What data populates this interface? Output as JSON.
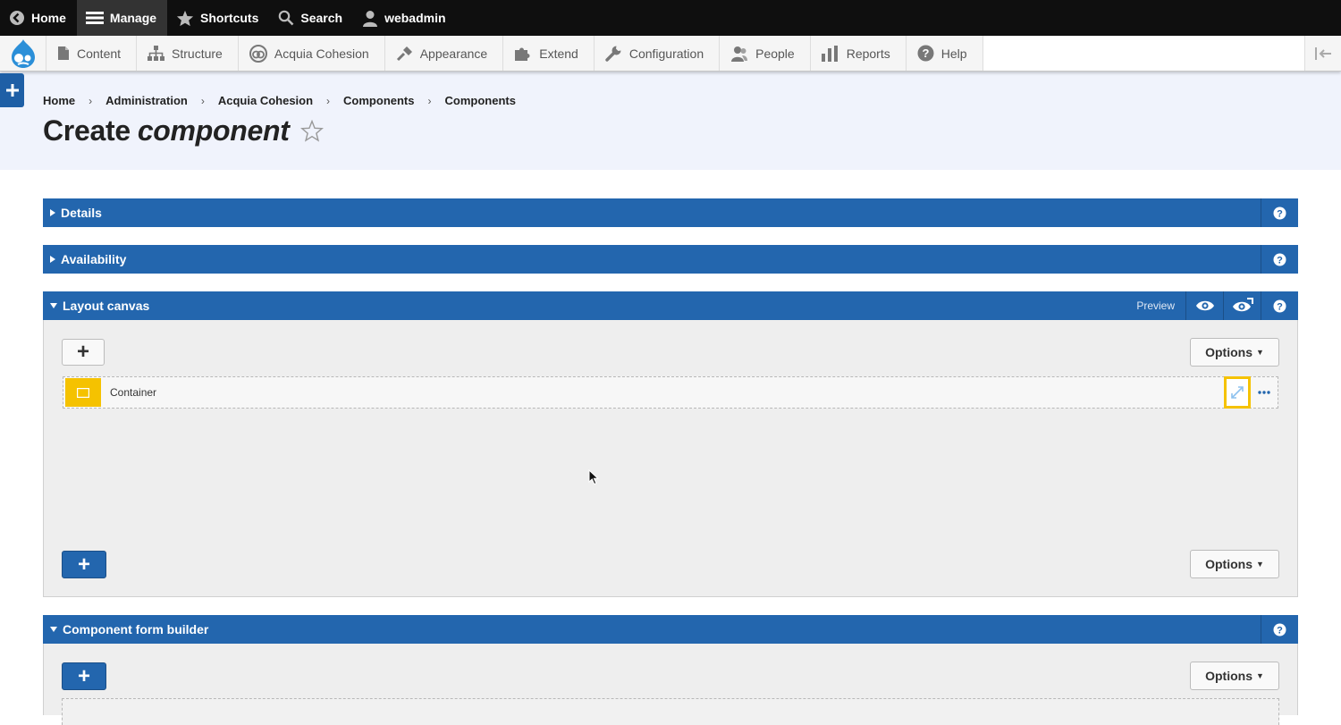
{
  "toolbar": {
    "items": [
      {
        "label": "Home",
        "icon": "back-arrow-icon"
      },
      {
        "label": "Manage",
        "icon": "hamburger-menu-icon",
        "active": true
      },
      {
        "label": "Shortcuts",
        "icon": "star-icon"
      },
      {
        "label": "Search",
        "icon": "search-icon"
      },
      {
        "label": "webadmin",
        "icon": "user-icon"
      }
    ]
  },
  "tray": {
    "items": [
      {
        "label": "Content",
        "icon": "document-icon"
      },
      {
        "label": "Structure",
        "icon": "structure-icon"
      },
      {
        "label": "Acquia Cohesion",
        "icon": "cohesion-icon"
      },
      {
        "label": "Appearance",
        "icon": "paint-icon"
      },
      {
        "label": "Extend",
        "icon": "puzzle-icon"
      },
      {
        "label": "Configuration",
        "icon": "wrench-icon"
      },
      {
        "label": "People",
        "icon": "people-icon"
      },
      {
        "label": "Reports",
        "icon": "bar-chart-icon"
      },
      {
        "label": "Help",
        "icon": "help-icon"
      }
    ]
  },
  "breadcrumb": [
    "Home",
    "Administration",
    "Acquia Cohesion",
    "Components",
    "Components"
  ],
  "page": {
    "title_prefix": "Create",
    "title_emph": "component"
  },
  "panels": {
    "details": {
      "title": "Details"
    },
    "availability": {
      "title": "Availability"
    },
    "layout_canvas": {
      "title": "Layout canvas",
      "preview_label": "Preview",
      "options_label": "Options",
      "add_label": "+",
      "row_label": "Container"
    },
    "form_builder": {
      "title": "Component form builder",
      "options_label": "Options",
      "add_label": "+"
    }
  },
  "colors": {
    "panel_header": "#2366ae",
    "highlight": "#f5c200",
    "toolbar": "#0f0f0f",
    "header_bg": "#f0f3fc"
  }
}
